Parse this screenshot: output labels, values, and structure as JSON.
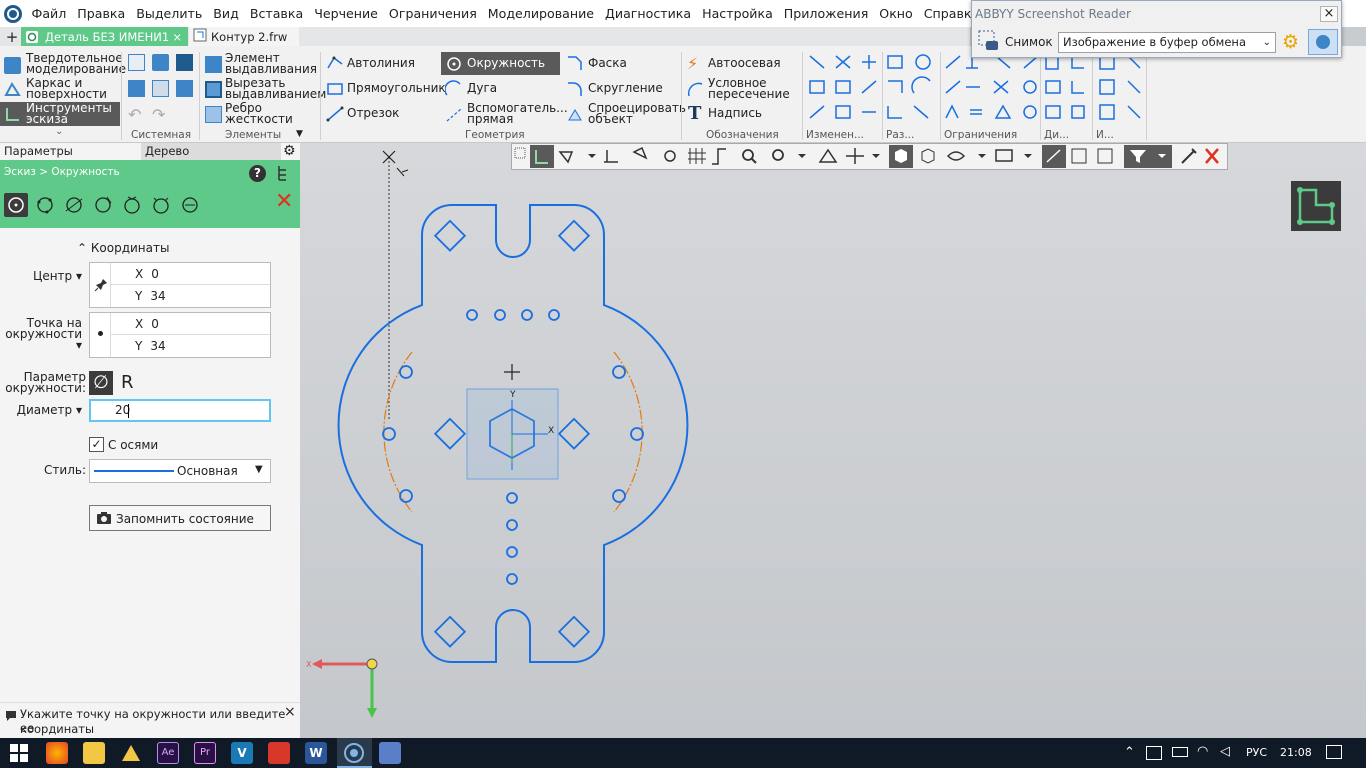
{
  "menu": [
    "Файл",
    "Правка",
    "Выделить",
    "Вид",
    "Вставка",
    "Черчение",
    "Ограничения",
    "Моделирование",
    "Диагностика",
    "Настройка",
    "Приложения",
    "Окно",
    "Справка"
  ],
  "tabs": {
    "active": "Деталь БЕЗ ИМЕНИ1",
    "second": "Контур 2.frw",
    "add_glyph": "+"
  },
  "abbyy": {
    "title": "ABBYY Screenshot Reader",
    "snapshot_label": "Снимок",
    "mode": "Изображение в буфер обмена",
    "close": "×"
  },
  "ribbon": {
    "left_modes": [
      "Твердотельное моделирование",
      "Каркас и поверхности",
      "Инструменты эскиза"
    ],
    "elements": [
      "Элемент выдавливания",
      "Вырезать выдавливанием",
      "Ребро жесткости"
    ],
    "geometry": [
      "Автолиния",
      "Окружность",
      "Фаска",
      "Прямоугольник",
      "Дуга",
      "Скругление",
      "Отрезок",
      "Вспомогательная прямая",
      "Спроецировать объект"
    ],
    "geometry_split": {
      "aux1": "Вспомогатель...",
      "aux2": "прямая",
      "proj1": "Спроецировать",
      "proj2": "объект",
      "elem1a": "Элемент",
      "elem1b": "выдавливания",
      "elem2a": "Вырезать",
      "elem2b": "выдавливанием",
      "elem3a": "Ребро",
      "elem3b": "жесткости",
      "mode1a": "Твердотельное",
      "mode1b": "моделирование",
      "mode2a": "Каркас и",
      "mode2b": "поверхности",
      "mode3a": "Инструменты",
      "mode3b": "эскиза",
      "des2a": "Условное",
      "des2b": "пересечение"
    },
    "designations": [
      "Автоосевая",
      "Условное пересечение",
      "Надпись"
    ],
    "group_labels": [
      "Системная",
      "Элементы",
      "Геометрия",
      "Обозначения",
      "Изменен...",
      "Раз...",
      "Ограничения",
      "Ди...",
      "И..."
    ]
  },
  "panel": {
    "tab_params": "Параметры",
    "tab_tree": "Дерево",
    "breadcrumb": "Эскиз > Окружность",
    "section": "Координаты",
    "center_label": "Центр",
    "center_x": "0",
    "center_y": "34",
    "point_label_1": "Точка на",
    "point_label_2": "окружности",
    "point_x": "0",
    "point_y": "34",
    "param_label_1": "Параметр",
    "param_label_2": "окружности:",
    "param_r": "R",
    "diameter_label": "Диаметр",
    "diameter_value": "20",
    "axes_label": "С осями",
    "style_label": "Стиль:",
    "style_value": "Основная",
    "save_state": "Запомнить состояние",
    "x": "X",
    "y": "Y"
  },
  "status": {
    "line1": "Укажите точку на окружности или введите ее",
    "line2": "координаты"
  },
  "taskbar": {
    "lang": "РУС",
    "time": "21:08"
  },
  "colors": {
    "accent_green": "#5fc98a",
    "sketch_blue": "#1a6fe0",
    "aux_orange": "#e07a1a",
    "selected_tool": "#5a5a5a"
  }
}
